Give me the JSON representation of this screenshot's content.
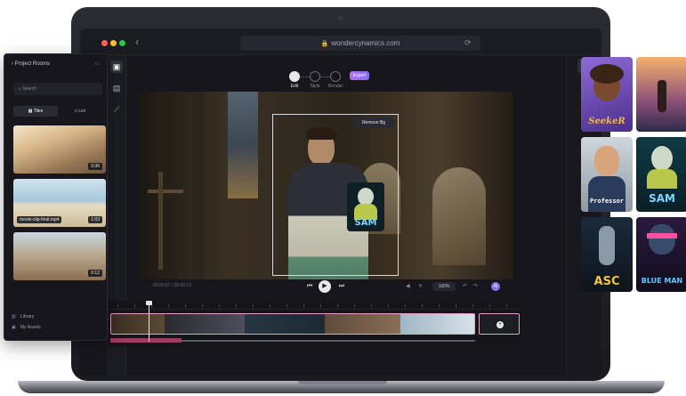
{
  "browser": {
    "url": "wondercynamics.com",
    "lock_icon": "lock-icon",
    "back_icon": "chevron-left-icon",
    "reload_icon": "reload-icon"
  },
  "steps": [
    {
      "label": "Edit",
      "state": "done"
    },
    {
      "label": "Style",
      "state": "todo"
    },
    {
      "label": "Render",
      "state": "todo"
    }
  ],
  "export_label": "Export",
  "canvas": {
    "bg_remove_label": "Remove Bg",
    "sticker_text": "SAM",
    "time_label": "00:00:07 / 00:00:12"
  },
  "playback": {
    "zoom": "100%",
    "prev_icon": "skip-back-icon",
    "play_icon": "play-icon",
    "next_icon": "skip-forward-icon",
    "ai_label": "AI"
  },
  "panel": {
    "title": "Project Rooms",
    "search_placeholder": "Search",
    "tabs": [
      "Tiles",
      "List"
    ],
    "items": [
      {
        "duration": "0:36",
        "filename": ""
      },
      {
        "duration": "1:03",
        "filename": "movie-clip-final.mp4"
      },
      {
        "duration": "0:12",
        "filename": ""
      }
    ],
    "footer": [
      "Library",
      "My Assets"
    ]
  },
  "avatars": [
    {
      "name": "SeekeR",
      "color": "#f2b84a"
    },
    {
      "name": "",
      "color": "#f4a05a"
    },
    {
      "name": "Professor",
      "color": "#e6e6e6"
    },
    {
      "name": "SAM",
      "color": "#7fd6ff"
    },
    {
      "name": "ASC",
      "color": "#f2c33a"
    },
    {
      "name": "BLUE MAN",
      "color": "#5ec6ff"
    }
  ],
  "accent": "#8f70f3"
}
